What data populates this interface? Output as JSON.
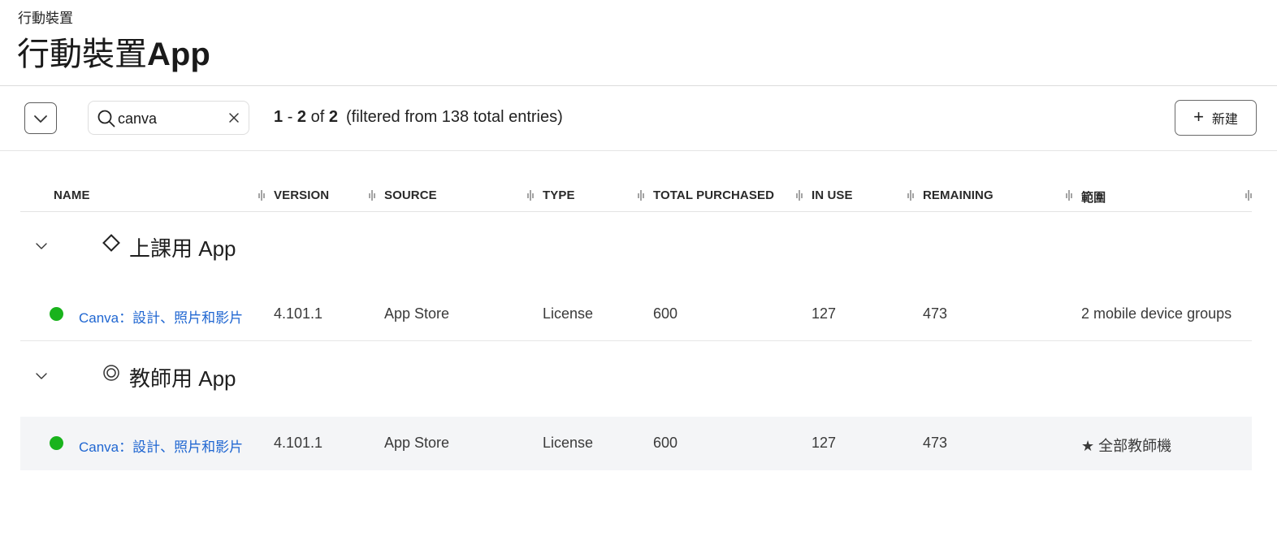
{
  "header": {
    "breadcrumb": "行動裝置",
    "title_cjk": "行動裝置",
    "title_latin": "App"
  },
  "toolbar": {
    "collapse_icon": "chevron-down-icon",
    "search": {
      "value": "canva",
      "placeholder": "",
      "icon": "search-icon",
      "clear_icon": "close-icon"
    },
    "count": {
      "from": "1",
      "sep": "-",
      "to": "2",
      "of": "of",
      "total": "2",
      "filter_text": "(filtered from 138 total entries)"
    },
    "new_button": {
      "icon": "plus-icon",
      "label": "新建"
    }
  },
  "table": {
    "columns": [
      "NAME",
      "VERSION",
      "SOURCE",
      "TYPE",
      "TOTAL PURCHASED",
      "IN USE",
      "REMAINING",
      "範圍"
    ],
    "groups": [
      {
        "icon": "diamond-icon",
        "title": "上課用 App",
        "rows": [
          {
            "status_color": "#19b31c",
            "name": "Canva：設計、照片和影片",
            "version": "4.101.1",
            "source": "App Store",
            "type": "License",
            "total_purchased": "600",
            "in_use": "127",
            "remaining": "473",
            "scope": "2 mobile device groups"
          }
        ]
      },
      {
        "icon": "double-circle-icon",
        "title": "教師用 App",
        "rows": [
          {
            "status_color": "#19b31c",
            "name": "Canva：設計、照片和影片",
            "version": "4.101.1",
            "source": "App Store",
            "type": "License",
            "total_purchased": "600",
            "in_use": "127",
            "remaining": "473",
            "scope": "★ 全部教師機"
          }
        ]
      }
    ]
  },
  "colors": {
    "link": "#1f66d1",
    "status_ok": "#19b31c",
    "row_highlight": "#f4f5f7"
  }
}
